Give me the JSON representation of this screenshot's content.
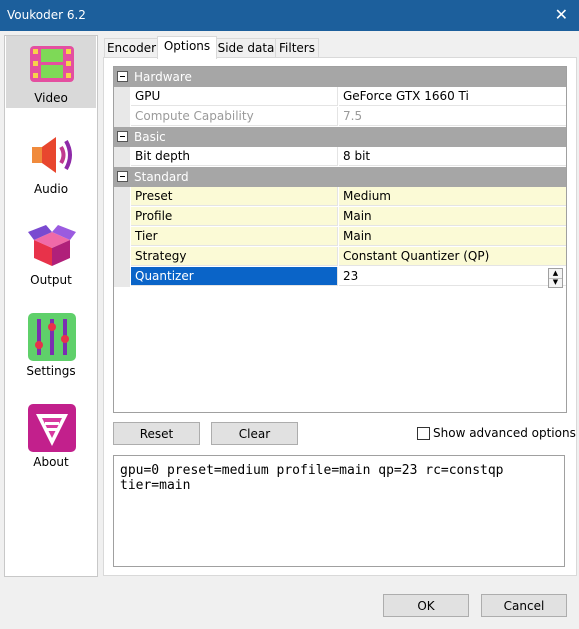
{
  "window": {
    "title": "Voukoder 6.2",
    "close_glyph": "✕"
  },
  "sidebar": {
    "items": [
      {
        "label": "Video",
        "icon": "film-icon"
      },
      {
        "label": "Audio",
        "icon": "speaker-icon"
      },
      {
        "label": "Output",
        "icon": "box-icon"
      },
      {
        "label": "Settings",
        "icon": "sliders-icon"
      },
      {
        "label": "About",
        "icon": "voukoder-logo-icon"
      }
    ]
  },
  "tabs": [
    "Encoder",
    "Options",
    "Side data",
    "Filters"
  ],
  "grid": {
    "categories": {
      "hardware": "Hardware",
      "basic": "Basic",
      "standard": "Standard"
    },
    "rows": {
      "gpu": {
        "key": "GPU",
        "value": "GeForce GTX 1660 Ti"
      },
      "compute": {
        "key": "Compute Capability",
        "value": "7.5"
      },
      "bitdepth": {
        "key": "Bit depth",
        "value": "8 bit"
      },
      "preset": {
        "key": "Preset",
        "value": "Medium"
      },
      "profile": {
        "key": "Profile",
        "value": "Main"
      },
      "tier": {
        "key": "Tier",
        "value": "Main"
      },
      "strategy": {
        "key": "Strategy",
        "value": "Constant Quantizer (QP)"
      },
      "quantizer": {
        "key": "Quantizer",
        "value": "23"
      }
    }
  },
  "buttons": {
    "reset": "Reset",
    "clear": "Clear",
    "ok": "OK",
    "cancel": "Cancel"
  },
  "advanced": {
    "label": "Show advanced options",
    "checked": false
  },
  "command": "gpu=0 preset=medium profile=main qp=23 rc=constqp\ntier=main"
}
